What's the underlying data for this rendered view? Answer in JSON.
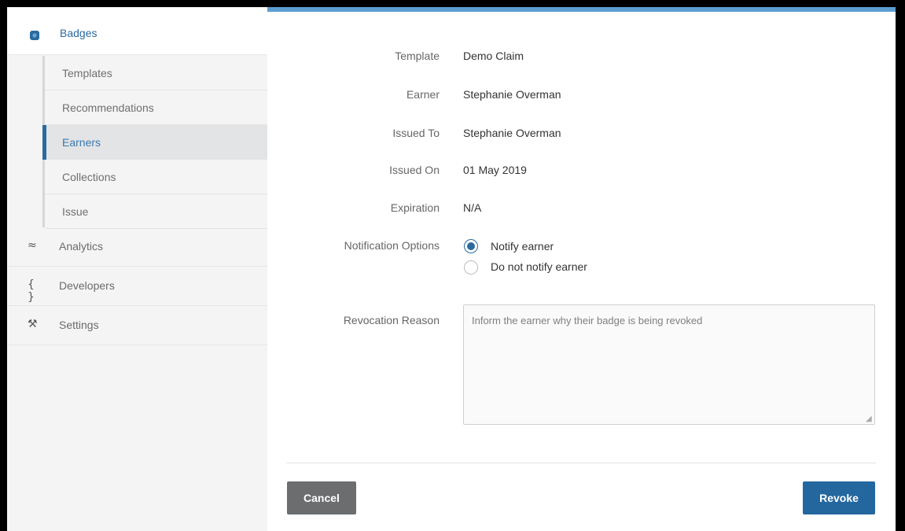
{
  "sidebar": {
    "badges": {
      "label": "Badges",
      "icon": "badge-icon"
    },
    "sub_items": [
      {
        "label": "Templates",
        "active": false
      },
      {
        "label": "Recommendations",
        "active": false
      },
      {
        "label": "Earners",
        "active": true
      },
      {
        "label": "Collections",
        "active": false
      },
      {
        "label": "Issue",
        "active": false
      }
    ],
    "main_items": [
      {
        "label": "Analytics",
        "icon": "analytics-icon",
        "glyph": "≈"
      },
      {
        "label": "Developers",
        "icon": "braces-icon",
        "glyph": "{ }"
      },
      {
        "label": "Settings",
        "icon": "tools-icon",
        "glyph": "⚒"
      }
    ]
  },
  "details": {
    "template_label": "Template",
    "template_value": "Demo Claim",
    "earner_label": "Earner",
    "earner_value": "Stephanie Overman",
    "issued_to_label": "Issued To",
    "issued_to_value": "Stephanie Overman",
    "issued_on_label": "Issued On",
    "issued_on_value": "01 May 2019",
    "expiration_label": "Expiration",
    "expiration_value": "N/A"
  },
  "notification": {
    "label": "Notification Options",
    "options": [
      {
        "label": "Notify earner",
        "selected": true
      },
      {
        "label": "Do not notify earner",
        "selected": false
      }
    ]
  },
  "revocation": {
    "label": "Revocation Reason",
    "value": "",
    "placeholder": "Inform the earner why their badge is being revoked"
  },
  "actions": {
    "cancel_label": "Cancel",
    "revoke_label": "Revoke"
  },
  "colors": {
    "accent": "#2b6aa0",
    "top_bar": "#5d9ed2",
    "cancel_bg": "#6b6d6f",
    "revoke_bg": "#24679f",
    "sidebar_bg": "#f4f4f4"
  }
}
